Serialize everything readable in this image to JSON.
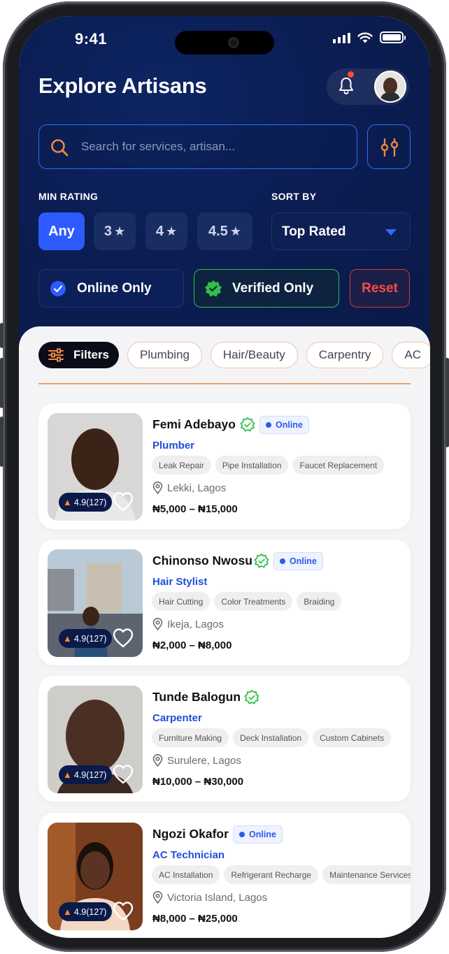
{
  "status_bar": {
    "time": "9:41"
  },
  "header": {
    "title": "Explore Artisans"
  },
  "search": {
    "placeholder": "Search for services, artisan..."
  },
  "filters": {
    "min_rating_label": "MIN RATING",
    "sort_by_label": "SORT BY",
    "ratings": [
      {
        "label": "Any",
        "active": true
      },
      {
        "label": "3",
        "active": false
      },
      {
        "label": "4",
        "active": false
      },
      {
        "label": "4.5",
        "active": false
      }
    ],
    "sort_value": "Top Rated",
    "online_only_label": "Online Only",
    "verified_only_label": "Verified Only",
    "reset_label": "Reset"
  },
  "categories": {
    "filters_label": "Filters",
    "items": [
      "Plumbing",
      "Hair/Beauty",
      "Carpentry",
      "AC"
    ]
  },
  "artisans": [
    {
      "name": "Femi Adebayo",
      "verified": true,
      "online": true,
      "online_label": "Online",
      "role": "Plumber",
      "tags": [
        "Leak Repair",
        "Pipe Installation",
        "Faucet Replacement"
      ],
      "location": "Lekki, Lagos",
      "price": "₦5,000 – ₦15,000",
      "rating": "4.9(127)"
    },
    {
      "name": "Chinonso Nwosu",
      "verified": true,
      "online": true,
      "online_label": "Online",
      "role": "Hair Stylist",
      "tags": [
        "Hair Cutting",
        "Color Treatments",
        "Braiding"
      ],
      "location": "Ikeja, Lagos",
      "price": "₦2,000 – ₦8,000",
      "rating": "4.9(127)"
    },
    {
      "name": "Tunde Balogun",
      "verified": true,
      "online": false,
      "online_label": "",
      "role": "Carpenter",
      "tags": [
        "Furniture Making",
        "Deck Installation",
        "Custom Cabinets"
      ],
      "location": "Surulere, Lagos",
      "price": "₦10,000 – ₦30,000",
      "rating": "4.9(127)"
    },
    {
      "name": "Ngozi Okafor",
      "verified": false,
      "online": true,
      "online_label": "Online",
      "role": "AC Technician",
      "tags": [
        "AC Installation",
        "Refrigerant Recharge",
        "Maintenance Services"
      ],
      "location": "Victoria Island, Lagos",
      "price": "₦8,000 – ₦25,000",
      "rating": "4.9(127)"
    }
  ],
  "colors": {
    "hero_bg": "#0b1d52",
    "accent_blue": "#2d5bff",
    "verified_green": "#2fc04a",
    "reset_red": "#ff4c43",
    "chip_border": "#f2c5aa",
    "search_icon_orange": "#f0883e"
  }
}
